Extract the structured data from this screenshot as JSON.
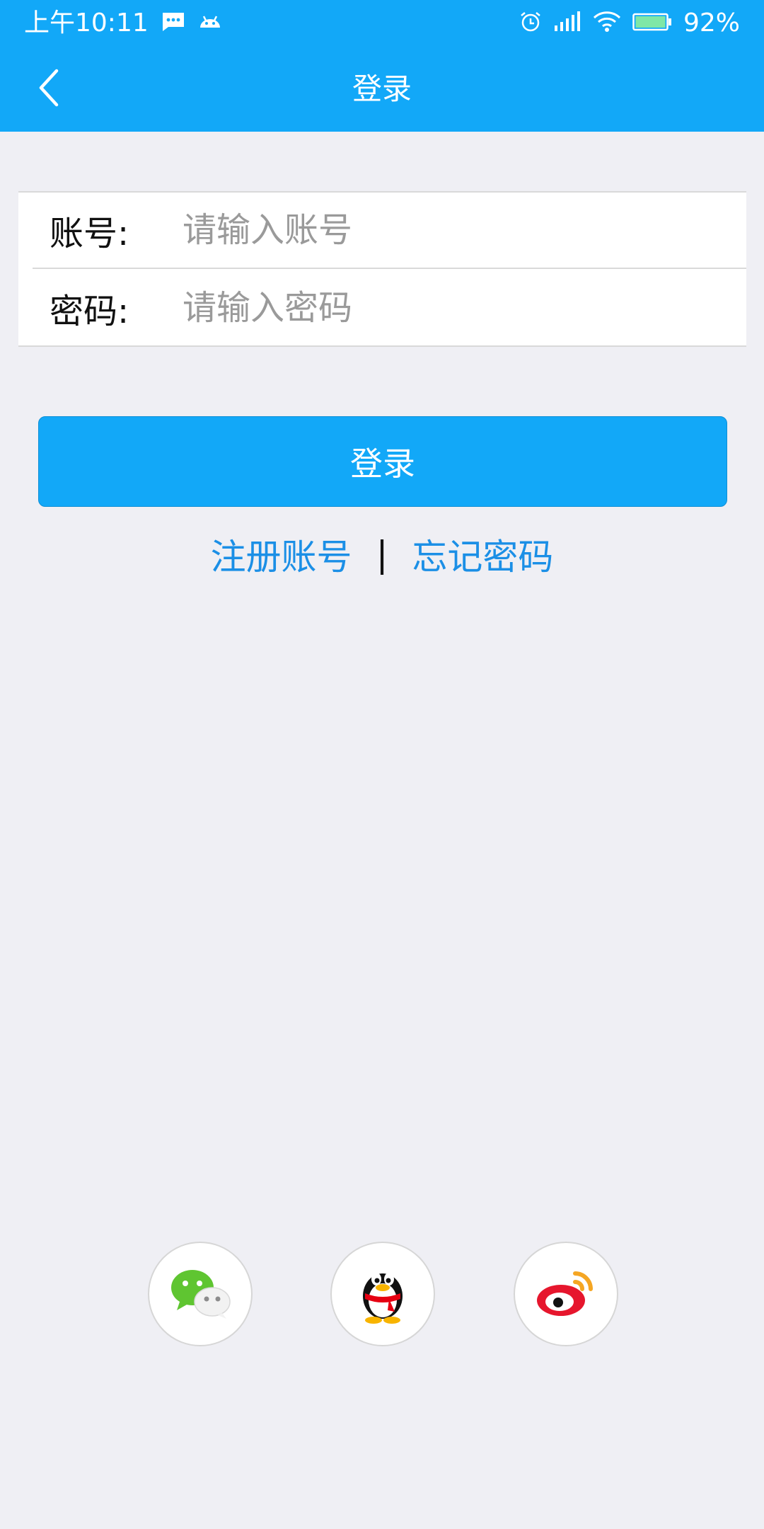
{
  "status_bar": {
    "time": "上午10:11",
    "battery": "92%",
    "icons": [
      "message-icon",
      "android-icon",
      "alarm-icon",
      "signal-icon",
      "wifi-icon",
      "battery-icon"
    ]
  },
  "header": {
    "title": "登录",
    "back_icon": "chevron-left-icon"
  },
  "form": {
    "account_label": "账号:",
    "account_placeholder": "请输入账号",
    "password_label": "密码:",
    "password_placeholder": "请输入密码"
  },
  "actions": {
    "login_label": "登录",
    "register_label": "注册账号",
    "separator": "|",
    "forgot_label": "忘记密码"
  },
  "social_login": {
    "icons": [
      "wechat-icon",
      "qq-icon",
      "weibo-icon"
    ]
  },
  "colors": {
    "primary": "#12a8f8",
    "link": "#1b8fe6",
    "background": "#efeff4"
  }
}
